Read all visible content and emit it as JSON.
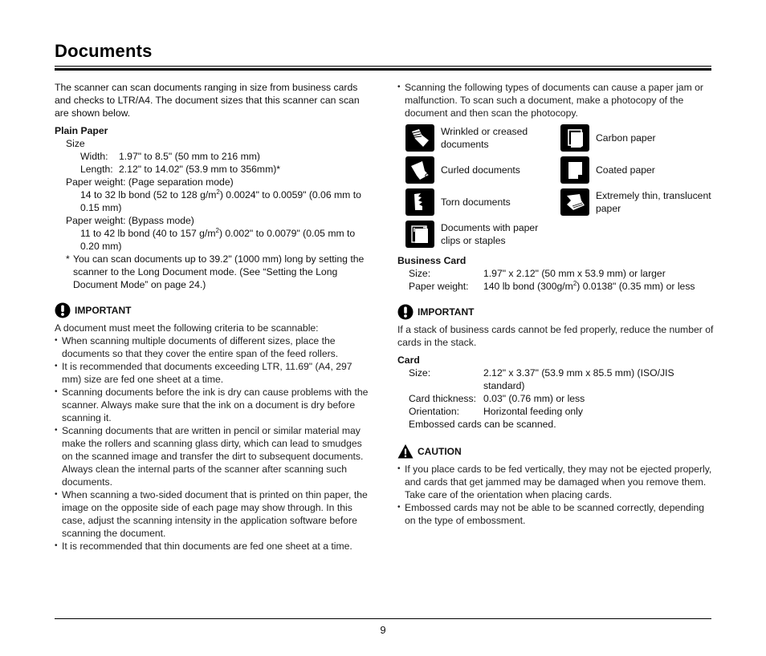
{
  "page": {
    "title": "Documents",
    "page_number": "9"
  },
  "left": {
    "intro": "The scanner can scan documents ranging in size from business cards and checks to LTR/A4. The document sizes that this scanner can scan are shown below.",
    "plain_paper": {
      "heading": "Plain Paper",
      "size_label": "Size",
      "width_label": "Width:",
      "width_value": "1.97\" to 8.5\" (50 mm to 216 mm)",
      "length_label": "Length:",
      "length_value": "2.12\" to 14.02\" (53.9 mm to 356mm)*",
      "weight_sep_label": "Paper weight: (Page separation mode)",
      "weight_sep_pre": "14 to 32 lb bond (52 to 128 g/m",
      "weight_sep_sup": "2",
      "weight_sep_post": ") 0.0024\" to 0.0059\" (0.06 mm to 0.15 mm)",
      "weight_bypass_label": "Paper weight: (Bypass mode)",
      "weight_bypass_pre": "11 to 42 lb bond (40 to 157 g/m",
      "weight_bypass_sup": "2",
      "weight_bypass_post": ") 0.002\" to 0.0079\" (0.05 mm to 0.20 mm)",
      "footnote_mark": "*",
      "footnote": "You can scan documents up to 39.2\" (1000 mm) long by setting the scanner to the Long Document mode. (See “Setting the Long Document Mode” on page 24.)"
    },
    "important": {
      "label": "IMPORTANT",
      "icon": "exclamation-circle-icon",
      "intro": "A document must meet the following criteria to be scannable:",
      "bullets": [
        "When scanning multiple documents of different sizes, place the documents so that they cover the entire span of the feed rollers.",
        "It is recommended that documents exceeding LTR, 11.69\" (A4, 297 mm) size are fed one sheet at a time.",
        "Scanning documents before the ink is dry can cause problems with the scanner. Always make sure that the ink on a document is dry before scanning it.",
        "Scanning documents that are written in pencil or similar material may make the rollers and scanning glass dirty, which can lead to smudges on the scanned image and transfer the dirt to subsequent documents. Always clean the internal parts of the scanner after scanning such documents.",
        "When scanning a two-sided document that is printed on thin paper, the image on the opposite side of each page may show through. In this case, adjust the scanning intensity in the application software before scanning the document.",
        "It is recommended that thin documents are fed one sheet at a time."
      ]
    }
  },
  "right": {
    "jam_bullet": "Scanning the following types of documents can cause a paper jam or malfunction. To scan such a document, make a photocopy of the document and then scan the photocopy.",
    "problem_docs": [
      {
        "icon": "wrinkled-document-icon",
        "label": "Wrinkled or creased documents"
      },
      {
        "icon": "carbon-paper-icon",
        "label": "Carbon paper"
      },
      {
        "icon": "curled-document-icon",
        "label": "Curled documents"
      },
      {
        "icon": "coated-paper-icon",
        "label": "Coated paper"
      },
      {
        "icon": "torn-document-icon",
        "label": "Torn documents"
      },
      {
        "icon": "thin-paper-icon",
        "label": "Extremely thin, translucent paper"
      },
      {
        "icon": "paper-clip-document-icon",
        "label": "Documents with paper clips or staples"
      }
    ],
    "business_card": {
      "heading": "Business Card",
      "size_label": "Size:",
      "size_value": "1.97\" x 2.12\" (50 mm x 53.9 mm) or larger",
      "weight_label": "Paper weight:",
      "weight_pre": "140 lb bond (300g/m",
      "weight_sup": "2",
      "weight_post": ") 0.0138\" (0.35 mm) or less"
    },
    "important": {
      "label": "IMPORTANT",
      "icon": "exclamation-circle-icon",
      "text": "If a stack of business cards cannot be fed properly, reduce the number of cards in the stack."
    },
    "card": {
      "heading": "Card",
      "size_label": "Size:",
      "size_value": "2.12\" x 3.37\" (53.9 mm x 85.5 mm) (ISO/JIS standard)",
      "thickness_label": "Card thickness:",
      "thickness_value": "0.03\" (0.76 mm) or less",
      "orientation_label": "Orientation:",
      "orientation_value": "Horizontal feeding only",
      "embossed_note": "Embossed cards can be scanned."
    },
    "caution": {
      "label": "CAUTION",
      "icon": "warning-triangle-icon",
      "bullets": [
        "If you place cards to be fed vertically, they may not be ejected properly, and cards that get jammed may be damaged when you remove them. Take care of the orientation when placing cards.",
        "Embossed cards may not be able to be scanned correctly, depending on the type of embossment."
      ]
    }
  }
}
